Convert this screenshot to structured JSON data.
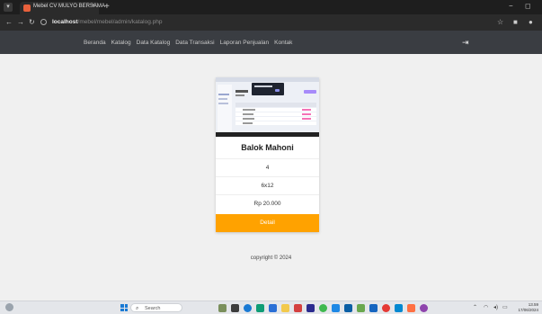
{
  "browser": {
    "tab_title": "Mebel CV MULYO BERSAMA",
    "tab_close": "×",
    "new_tab": "+",
    "window_min": "−",
    "window_max": "◻",
    "url_host": "localhost",
    "url_path": "/mebel/mebel/admin/katalog.php",
    "icons": [
      "back-icon",
      "forward-icon",
      "reload-icon",
      "site-info-icon",
      "star-icon",
      "extension-icon",
      "profile-icon"
    ]
  },
  "site_nav": {
    "items": [
      "Beranda",
      "Katalog",
      "Data Katalog",
      "Data Transaksi",
      "Laporan Penjualan",
      "Kontak"
    ],
    "logout_icon": "logout-icon"
  },
  "product": {
    "name": "Balok Mahoni",
    "stock": "4",
    "size": "6x12",
    "price": "Rp 20.000",
    "detail_label": "Detail"
  },
  "footer": {
    "copyright": "copyright © 2024"
  },
  "taskbar": {
    "search_placeholder": "Search",
    "time": "13.59",
    "date": "17/06/2024"
  },
  "colors": {
    "accent": "#ffa200",
    "navbar": "#3a3d42",
    "browser_chrome": "#2b2b2b"
  }
}
